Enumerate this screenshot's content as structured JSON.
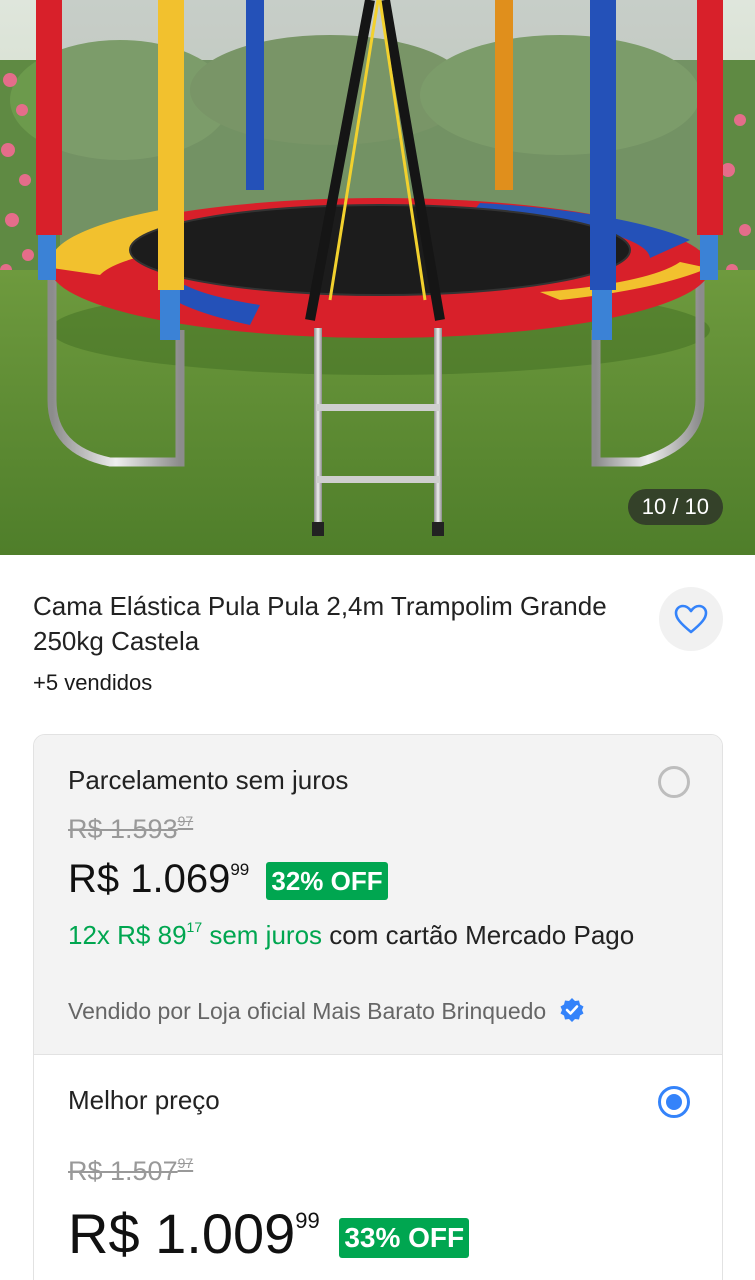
{
  "gallery": {
    "counter": "10 / 10",
    "image_icon": "trampoline-product-photo"
  },
  "product": {
    "title": "Cama Elástica Pula Pula 2,4m Trampolim Grande 250kg Castela",
    "sold": "+5 vendidos",
    "favorite_icon": "heart-icon"
  },
  "offers": [
    {
      "label": "Parcelamento sem juros",
      "selected": false,
      "old_price_int": "R$ 1.593",
      "old_price_cents": "97",
      "price_int": "R$ 1.069",
      "price_cents": "99",
      "discount": "32% OFF",
      "installments_prefix": "12x R$ 89",
      "installments_cents": "17",
      "installments_suffix": "sem juros",
      "installments_note": " com cartão Mercado Pago",
      "seller": "Vendido por Loja oficial Mais Barato Brinquedo",
      "seller_icon": "verified-badge-icon"
    },
    {
      "label": "Melhor preço",
      "selected": true,
      "old_price_int": "R$ 1.507",
      "old_price_cents": "97",
      "price_int": "R$ 1.009",
      "price_cents": "99",
      "discount": "33% OFF"
    }
  ],
  "colors": {
    "accent_green": "#00a650",
    "accent_blue": "#3483fa"
  }
}
